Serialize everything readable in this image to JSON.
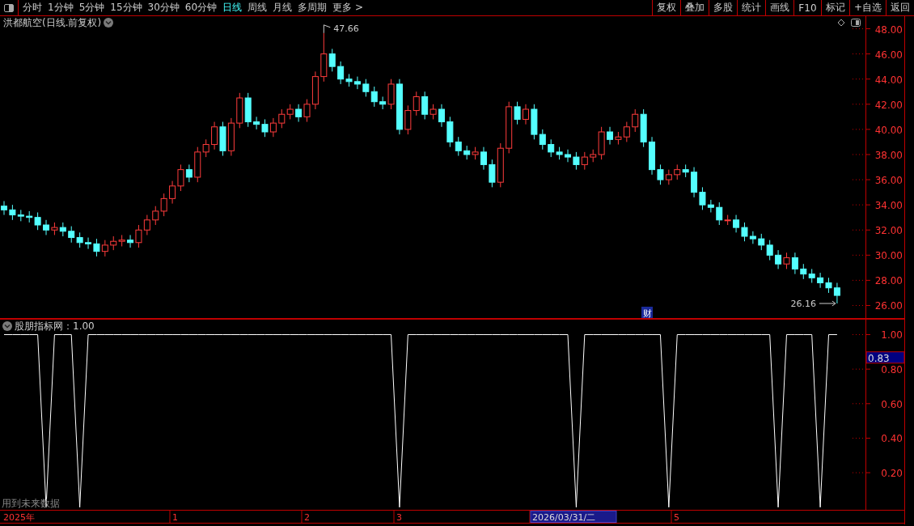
{
  "toolbar": {
    "periods": [
      {
        "label": "分时",
        "selected": false
      },
      {
        "label": "1分钟",
        "selected": false
      },
      {
        "label": "5分钟",
        "selected": false
      },
      {
        "label": "15分钟",
        "selected": false
      },
      {
        "label": "30分钟",
        "selected": false
      },
      {
        "label": "60分钟",
        "selected": false
      },
      {
        "label": "日线",
        "selected": true
      },
      {
        "label": "周线",
        "selected": false
      },
      {
        "label": "月线",
        "selected": false
      },
      {
        "label": "多周期",
        "selected": false
      },
      {
        "label": "更多 >",
        "selected": false
      }
    ],
    "buttons": [
      "复权",
      "叠加",
      "多股",
      "统计",
      "画线",
      "F10",
      "标记",
      "+自选",
      "返回"
    ]
  },
  "price_panel": {
    "title": "洪都航空(日线.前复权)",
    "high_marker": "47.66",
    "low_marker": "26.16",
    "event_badge": "财",
    "chart_data": {
      "type": "candlestick",
      "ylim": [
        24.97,
        49.0
      ],
      "yticks": [
        {
          "value": 48,
          "label": "48.00"
        },
        {
          "value": 46,
          "label": "46.00"
        },
        {
          "value": 44,
          "label": "44.00"
        },
        {
          "value": 42,
          "label": "42.00"
        },
        {
          "value": 40,
          "label": "40.00"
        },
        {
          "value": 38,
          "label": "38.00"
        },
        {
          "value": 36,
          "label": "36.00"
        },
        {
          "value": 34,
          "label": "34.00"
        },
        {
          "value": 32,
          "label": "32.00"
        },
        {
          "value": 30,
          "label": "30.00"
        },
        {
          "value": 28,
          "label": "28.00"
        },
        {
          "value": 26,
          "label": "26.00"
        }
      ],
      "categories": [
        null,
        null,
        null,
        null,
        null,
        null,
        null,
        null,
        null,
        null,
        null,
        null,
        null,
        null,
        null,
        null,
        null,
        null,
        null,
        null,
        null,
        null,
        null,
        null,
        null,
        null,
        null,
        null,
        null,
        null,
        null,
        null,
        null,
        null,
        null,
        null,
        null,
        null,
        null,
        null,
        null,
        null,
        null,
        null,
        null,
        null,
        null,
        null,
        null,
        null,
        null,
        null,
        null,
        null,
        null,
        null,
        null,
        null,
        null,
        null,
        null,
        null,
        null,
        null,
        null,
        null,
        null,
        null,
        null,
        null,
        null,
        null,
        null,
        null,
        null,
        null,
        null,
        null,
        null,
        null,
        null,
        null,
        null,
        null,
        null,
        null,
        null,
        null,
        null,
        null,
        null,
        null,
        null,
        null,
        null,
        null,
        null,
        null,
        null,
        null
      ],
      "ohlc": [
        [
          33.9,
          34.3,
          33.2,
          33.6
        ],
        [
          33.6,
          34.0,
          32.8,
          33.2
        ],
        [
          33.2,
          33.6,
          32.7,
          33.1
        ],
        [
          33.1,
          33.5,
          32.6,
          33.0
        ],
        [
          33.0,
          33.4,
          32.0,
          32.4
        ],
        [
          32.4,
          32.8,
          31.6,
          32.0
        ],
        [
          32.0,
          32.6,
          31.6,
          32.2
        ],
        [
          32.2,
          32.6,
          31.5,
          31.9
        ],
        [
          31.9,
          32.3,
          31.0,
          31.4
        ],
        [
          31.4,
          31.8,
          30.6,
          31.0
        ],
        [
          31.0,
          31.4,
          30.5,
          30.9
        ],
        [
          30.9,
          31.3,
          29.9,
          30.3
        ],
        [
          30.3,
          31.2,
          29.9,
          30.8
        ],
        [
          30.8,
          31.5,
          30.4,
          31.1
        ],
        [
          31.1,
          31.6,
          30.7,
          31.2
        ],
        [
          31.2,
          31.6,
          30.6,
          31.0
        ],
        [
          31.0,
          32.4,
          30.6,
          32.0
        ],
        [
          32.0,
          33.2,
          31.6,
          32.8
        ],
        [
          32.8,
          33.9,
          32.4,
          33.5
        ],
        [
          33.5,
          34.9,
          33.1,
          34.5
        ],
        [
          34.5,
          35.9,
          34.1,
          35.5
        ],
        [
          35.5,
          37.2,
          35.1,
          36.8
        ],
        [
          36.8,
          37.2,
          35.8,
          36.2
        ],
        [
          36.2,
          38.6,
          35.8,
          38.2
        ],
        [
          38.2,
          39.2,
          37.8,
          38.8
        ],
        [
          38.8,
          40.6,
          38.4,
          40.2
        ],
        [
          40.2,
          40.6,
          37.9,
          38.3
        ],
        [
          38.3,
          40.9,
          37.9,
          40.5
        ],
        [
          40.5,
          42.9,
          40.1,
          42.5
        ],
        [
          42.5,
          42.9,
          40.2,
          40.6
        ],
        [
          40.6,
          41.0,
          40.0,
          40.4
        ],
        [
          40.4,
          40.8,
          39.4,
          39.8
        ],
        [
          39.8,
          40.9,
          39.4,
          40.5
        ],
        [
          40.5,
          41.6,
          40.1,
          41.2
        ],
        [
          41.2,
          42.0,
          40.8,
          41.6
        ],
        [
          41.6,
          42.0,
          40.6,
          41.0
        ],
        [
          41.0,
          42.4,
          40.6,
          42.0
        ],
        [
          42.0,
          44.6,
          41.6,
          44.2
        ],
        [
          44.2,
          47.66,
          43.8,
          46.0
        ],
        [
          46.0,
          46.4,
          44.6,
          45.0
        ],
        [
          45.0,
          45.4,
          43.6,
          44.0
        ],
        [
          44.0,
          44.4,
          43.4,
          43.8
        ],
        [
          43.8,
          44.2,
          43.2,
          43.6
        ],
        [
          43.6,
          44.0,
          42.6,
          43.0
        ],
        [
          43.0,
          43.4,
          41.8,
          42.2
        ],
        [
          42.2,
          42.6,
          41.6,
          42.0
        ],
        [
          42.0,
          44.0,
          41.6,
          43.6
        ],
        [
          43.6,
          44.0,
          39.6,
          40.0
        ],
        [
          40.0,
          41.9,
          39.6,
          41.5
        ],
        [
          41.5,
          43.0,
          41.1,
          42.6
        ],
        [
          42.6,
          43.0,
          40.8,
          41.2
        ],
        [
          41.2,
          42.0,
          40.8,
          41.6
        ],
        [
          41.6,
          42.0,
          40.2,
          40.6
        ],
        [
          40.6,
          41.0,
          38.6,
          39.0
        ],
        [
          39.0,
          39.4,
          37.9,
          38.3
        ],
        [
          38.3,
          38.7,
          37.6,
          38.0
        ],
        [
          38.0,
          38.6,
          37.6,
          38.2
        ],
        [
          38.2,
          38.6,
          36.8,
          37.2
        ],
        [
          37.2,
          37.6,
          35.4,
          35.8
        ],
        [
          35.8,
          38.9,
          35.4,
          38.5
        ],
        [
          38.5,
          42.2,
          38.1,
          41.8
        ],
        [
          41.8,
          42.2,
          40.4,
          40.8
        ],
        [
          40.8,
          42.0,
          40.4,
          41.6
        ],
        [
          41.6,
          42.0,
          39.2,
          39.6
        ],
        [
          39.6,
          40.0,
          38.4,
          38.8
        ],
        [
          38.8,
          39.2,
          37.8,
          38.2
        ],
        [
          38.2,
          38.6,
          37.6,
          38.0
        ],
        [
          38.0,
          38.4,
          37.4,
          37.8
        ],
        [
          37.8,
          38.2,
          36.8,
          37.2
        ],
        [
          37.2,
          38.2,
          36.8,
          37.8
        ],
        [
          37.8,
          38.4,
          37.4,
          38.0
        ],
        [
          38.0,
          40.2,
          37.6,
          39.8
        ],
        [
          39.8,
          40.2,
          38.8,
          39.2
        ],
        [
          39.2,
          39.8,
          38.8,
          39.4
        ],
        [
          39.4,
          40.6,
          39.0,
          40.2
        ],
        [
          40.2,
          41.6,
          39.8,
          41.2
        ],
        [
          41.2,
          41.6,
          38.6,
          39.0
        ],
        [
          39.0,
          39.4,
          36.4,
          36.8
        ],
        [
          36.8,
          37.2,
          35.6,
          36.0
        ],
        [
          36.0,
          36.8,
          35.6,
          36.4
        ],
        [
          36.4,
          37.2,
          36.0,
          36.8
        ],
        [
          36.8,
          37.2,
          36.2,
          36.6
        ],
        [
          36.6,
          37.0,
          34.6,
          35.0
        ],
        [
          35.0,
          35.4,
          33.6,
          34.0
        ],
        [
          34.0,
          34.4,
          33.4,
          33.8
        ],
        [
          33.8,
          34.2,
          32.4,
          32.8
        ],
        [
          32.8,
          33.2,
          32.4,
          32.8
        ],
        [
          32.8,
          33.2,
          31.8,
          32.2
        ],
        [
          32.2,
          32.6,
          31.1,
          31.5
        ],
        [
          31.5,
          31.9,
          30.9,
          31.3
        ],
        [
          31.3,
          31.7,
          30.4,
          30.8
        ],
        [
          30.8,
          31.2,
          29.6,
          30.0
        ],
        [
          30.0,
          30.4,
          28.9,
          29.3
        ],
        [
          29.3,
          30.2,
          28.9,
          29.8
        ],
        [
          29.8,
          30.2,
          28.5,
          28.9
        ],
        [
          28.9,
          29.3,
          28.1,
          28.5
        ],
        [
          28.5,
          28.9,
          27.8,
          28.2
        ],
        [
          28.2,
          28.6,
          27.4,
          27.8
        ],
        [
          27.8,
          28.2,
          27.0,
          27.4
        ],
        [
          27.4,
          27.8,
          26.16,
          26.8
        ]
      ]
    }
  },
  "indicator_panel": {
    "title": "股朋指标网：1.00",
    "cursor_value": "0.83",
    "note": "用到未来数据",
    "chart_data": {
      "type": "line",
      "ylim": [
        -0.015,
        1.089
      ],
      "yticks": [
        {
          "value": 1,
          "label": "1.00"
        },
        {
          "value": 0.8,
          "label": "0.80"
        },
        {
          "value": 0.6,
          "label": "0.60"
        },
        {
          "value": 0.4,
          "label": "0.40"
        },
        {
          "value": 0.2,
          "label": "0.20"
        }
      ],
      "categories": [
        null,
        null,
        null,
        null,
        null,
        null,
        null,
        null,
        null,
        null,
        null,
        null,
        null,
        null,
        null,
        null,
        null,
        null,
        null,
        null,
        null,
        null,
        null,
        null,
        null,
        null,
        null,
        null,
        null,
        null,
        null,
        null,
        null,
        null,
        null,
        null,
        null,
        null,
        null,
        null,
        null,
        null,
        null,
        null,
        null,
        null,
        null,
        null,
        null,
        null,
        null,
        null,
        null,
        null,
        null,
        null,
        null,
        null,
        null,
        null,
        null,
        null,
        null,
        null,
        null,
        null,
        null,
        null,
        null,
        null,
        null,
        null,
        null,
        null,
        null,
        null,
        null,
        null,
        null,
        null,
        null,
        null,
        null,
        null,
        null,
        null,
        null,
        null,
        null,
        null,
        null,
        null,
        null,
        null,
        null,
        null,
        null,
        null,
        null,
        null
      ],
      "values": [
        1,
        1,
        1,
        1,
        1,
        0,
        1,
        1,
        1,
        0,
        1,
        1,
        1,
        1,
        1,
        1,
        1,
        1,
        1,
        1,
        1,
        1,
        1,
        1,
        1,
        1,
        1,
        1,
        1,
        1,
        1,
        1,
        1,
        1,
        1,
        1,
        1,
        1,
        1,
        1,
        1,
        1,
        1,
        1,
        1,
        1,
        1,
        0,
        1,
        1,
        1,
        1,
        1,
        1,
        1,
        1,
        1,
        1,
        1,
        1,
        1,
        1,
        1,
        1,
        1,
        1,
        1,
        1,
        0,
        1,
        1,
        1,
        1,
        1,
        1,
        1,
        1,
        1,
        1,
        0,
        1,
        1,
        1,
        1,
        1,
        1,
        1,
        1,
        1,
        1,
        1,
        1,
        0,
        1,
        1,
        1,
        1,
        0,
        1,
        1
      ]
    }
  },
  "time_axis": [
    {
      "label": "2025年",
      "selected": false
    },
    {
      "label": "1",
      "selected": false
    },
    {
      "label": "2",
      "selected": false
    },
    {
      "label": "3",
      "selected": false
    },
    {
      "label": "2026/03/31/二",
      "selected": true
    },
    {
      "label": "5",
      "selected": false
    }
  ]
}
